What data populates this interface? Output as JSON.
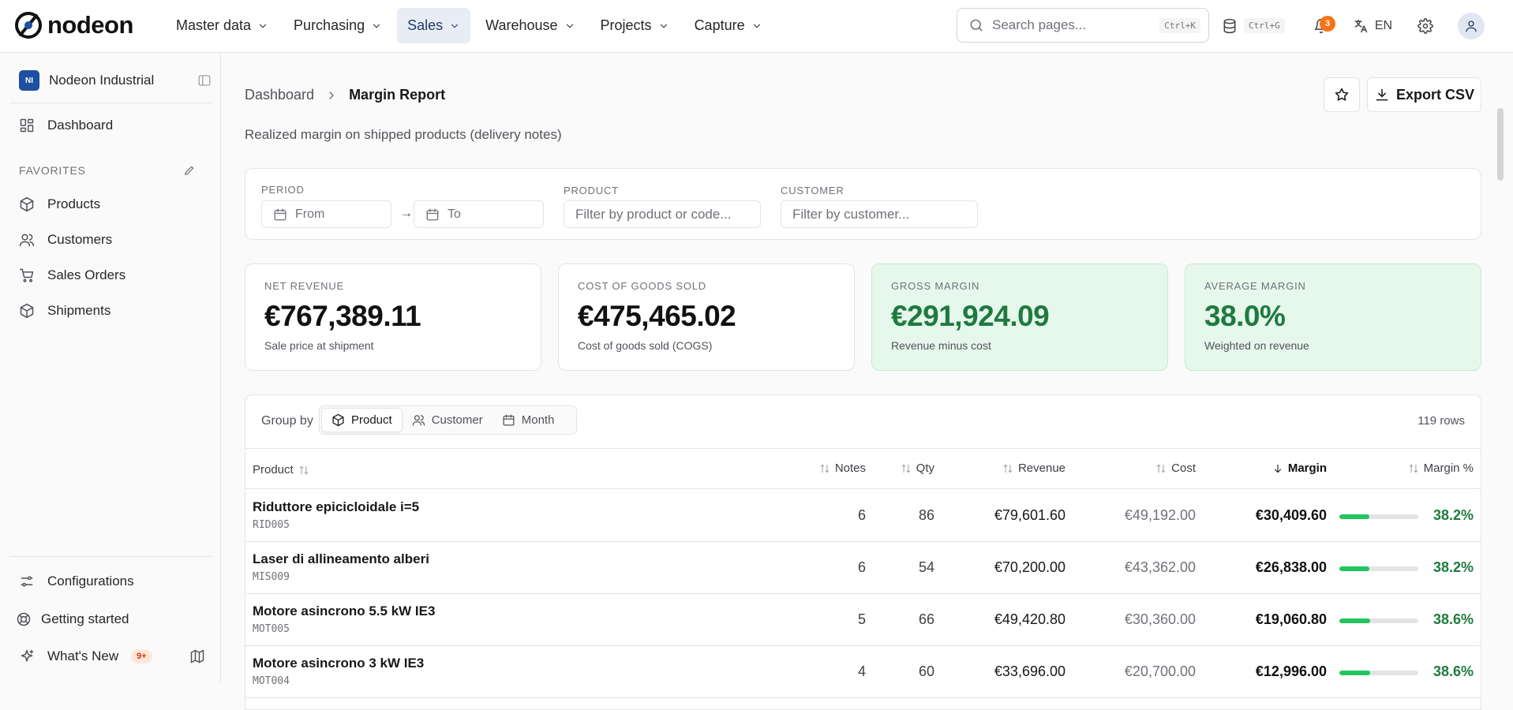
{
  "brand": {
    "name": "nodeon",
    "accent": "#1e4fa0",
    "success": "#1f7a3f"
  },
  "nav": {
    "items": [
      {
        "label": "Master data"
      },
      {
        "label": "Purchasing"
      },
      {
        "label": "Sales",
        "active": true
      },
      {
        "label": "Warehouse"
      },
      {
        "label": "Projects"
      },
      {
        "label": "Capture"
      }
    ]
  },
  "search": {
    "placeholder": "Search pages...",
    "shortcut": "Ctrl+K"
  },
  "toolbar": {
    "db_shortcut": "Ctrl+G",
    "notifications_count": "3",
    "language": "EN"
  },
  "sidebar": {
    "org_initials": "NI",
    "org_name": "Nodeon Industrial",
    "dashboard_label": "Dashboard",
    "favorites_title": "FAVORITES",
    "favorites": [
      {
        "label": "Products",
        "icon": "box-icon"
      },
      {
        "label": "Customers",
        "icon": "users-icon"
      },
      {
        "label": "Sales Orders",
        "icon": "cart-icon"
      },
      {
        "label": "Shipments",
        "icon": "box-icon"
      }
    ],
    "configurations": "Configurations",
    "getting_started": "Getting started",
    "whats_new": "What's New",
    "whats_new_badge": "9+"
  },
  "page": {
    "breadcrumb_root": "Dashboard",
    "breadcrumb_current": "Margin Report",
    "export_label": "Export CSV",
    "subtitle": "Realized margin on shipped products (delivery notes)"
  },
  "filters": {
    "period_label": "PERIOD",
    "from_placeholder": "From",
    "to_placeholder": "To",
    "arrow": "→",
    "product_label": "PRODUCT",
    "product_placeholder": "Filter by product or code...",
    "customer_label": "CUSTOMER",
    "customer_placeholder": "Filter by customer..."
  },
  "kpis": [
    {
      "label": "NET REVENUE",
      "value": "€767,389.11",
      "sub": "Sale price at shipment"
    },
    {
      "label": "COST OF GOODS SOLD",
      "value": "€475,465.02",
      "sub": "Cost of goods sold (COGS)"
    },
    {
      "label": "GROSS MARGIN",
      "value": "€291,924.09",
      "sub": "Revenue minus cost"
    },
    {
      "label": "AVERAGE MARGIN",
      "value": "38.0%",
      "sub": "Weighted on revenue"
    }
  ],
  "table": {
    "group_by_label": "Group by",
    "group_options": [
      "Product",
      "Customer",
      "Month"
    ],
    "row_count": "119 rows",
    "columns": [
      "Product",
      "Notes",
      "Qty",
      "Revenue",
      "Cost",
      "Margin",
      "Margin %"
    ],
    "rows": [
      {
        "name": "Riduttore epicicloidale i=5",
        "code": "RID005",
        "notes": "6",
        "qty": "86",
        "revenue": "€79,601.60",
        "cost": "€49,192.00",
        "margin": "€30,409.60",
        "pct": "38.2%",
        "pct_value": 0.382
      },
      {
        "name": "Laser di allineamento alberi",
        "code": "MIS009",
        "notes": "6",
        "qty": "54",
        "revenue": "€70,200.00",
        "cost": "€43,362.00",
        "margin": "€26,838.00",
        "pct": "38.2%",
        "pct_value": 0.382
      },
      {
        "name": "Motore asincrono 5.5 kW IE3",
        "code": "MOT005",
        "notes": "5",
        "qty": "66",
        "revenue": "€49,420.80",
        "cost": "€30,360.00",
        "margin": "€19,060.80",
        "pct": "38.6%",
        "pct_value": 0.386
      },
      {
        "name": "Motore asincrono 3 kW IE3",
        "code": "MOT004",
        "notes": "4",
        "qty": "60",
        "revenue": "€33,696.00",
        "cost": "€20,700.00",
        "margin": "€12,996.00",
        "pct": "38.6%",
        "pct_value": 0.386
      }
    ]
  }
}
